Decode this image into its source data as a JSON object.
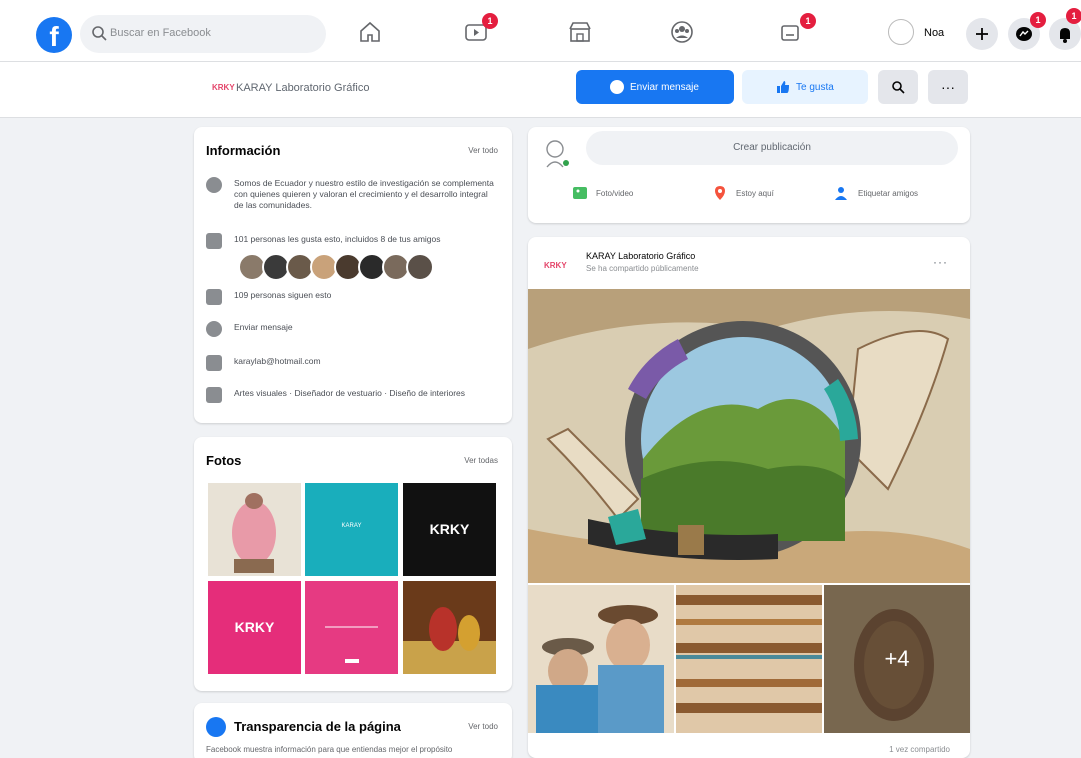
{
  "topnav": {
    "logo": "f",
    "search_placeholder": "Buscar en Facebook",
    "badges": {
      "watch": "1",
      "gaming": "1",
      "messenger": "1",
      "notifications": "1"
    },
    "user_name": "Noa"
  },
  "page_header": {
    "logo": "KRKY",
    "title": "KARAY Laboratorio Gráfico",
    "send_message": "Enviar mensaje",
    "liked": "Te gusta",
    "more": "···"
  },
  "info": {
    "title": "Información",
    "see_all": "Ver todo",
    "rows": [
      "Somos de Ecuador y nuestro estilo de investigación se complementa con quienes quieren y valoran el crecimiento y el desarrollo integral de las comunidades.",
      "101 personas les gusta esto, incluidos 8 de tus amigos",
      "109 personas siguen esto",
      "Enviar mensaje",
      "karaylab@hotmail.com",
      "Artes visuales · Diseñador de vestuario · Diseño de interiores"
    ]
  },
  "photos": {
    "title": "Fotos",
    "see_all": "Ver todas",
    "tile_texts": [
      "KARAY",
      "KRKY",
      "KRKY"
    ]
  },
  "transparency": {
    "title": "Transparencia de la página",
    "see_all": "Ver todo",
    "subtitle": "Facebook muestra información para que entiendas mejor el propósito"
  },
  "create_post": {
    "prompt": "Crear publicación",
    "actions": [
      "Foto/video",
      "Estoy aquí",
      "Etiquetar amigos"
    ]
  },
  "post": {
    "logo": "KRKY",
    "author": "KARAY Laboratorio Gráfico",
    "time": "Se ha compartido públicamente",
    "more": "···",
    "extra_photos": "+4",
    "footer": "1 vez compartido"
  },
  "colors": {
    "accent": "#1877f2",
    "badge": "#e41e3f",
    "brand_pink": "#e4456a"
  }
}
